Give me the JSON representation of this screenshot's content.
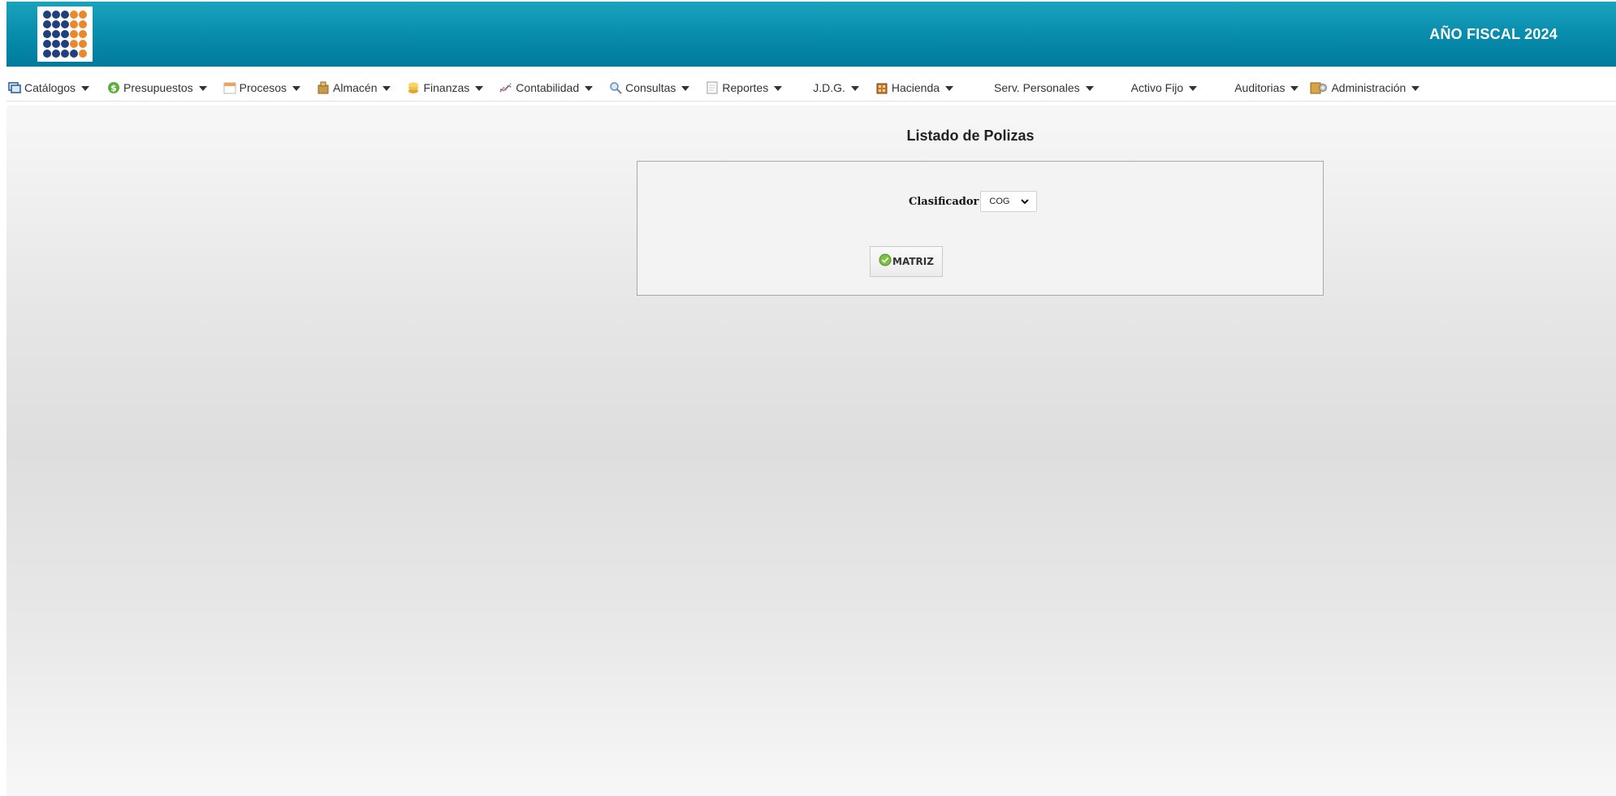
{
  "header": {
    "logo_icon": "dot-grid-logo-icon",
    "fiscal_year_label": "AÑO FISCAL  2024",
    "colors": {
      "header_bg": "#0a8fae",
      "text": "#ffffff"
    }
  },
  "menu": {
    "items": [
      {
        "label": "Catálogos",
        "icon": "window-icon",
        "has_caret": true
      },
      {
        "label": "Presupuestos",
        "icon": "dollar-icon",
        "has_caret": true
      },
      {
        "label": "Procesos",
        "icon": "calendar-icon",
        "has_caret": true
      },
      {
        "label": "Almacén",
        "icon": "box-icon",
        "has_caret": true
      },
      {
        "label": "Finanzas",
        "icon": "coins-icon",
        "has_caret": true
      },
      {
        "label": "Contabilidad",
        "icon": "chart-line-icon",
        "has_caret": true
      },
      {
        "label": "Consultas",
        "icon": "magnifier-icon",
        "has_caret": true
      },
      {
        "label": "Reportes",
        "icon": "document-icon",
        "has_caret": true
      },
      {
        "label": "J.D.G.",
        "icon": "",
        "has_caret": true
      },
      {
        "label": "Hacienda",
        "icon": "building-icon",
        "has_caret": true
      },
      {
        "label": "Serv. Personales",
        "icon": "",
        "has_caret": true
      },
      {
        "label": "Activo Fijo",
        "icon": "",
        "has_caret": true
      },
      {
        "label": "Auditorias",
        "icon": "",
        "has_caret": true
      },
      {
        "label": "Administración",
        "icon": "admin-icon",
        "has_caret": true
      }
    ]
  },
  "main": {
    "title": "Listado de Polizas",
    "form": {
      "clasificador_label": "Clasificador",
      "clasificador_value": "COG",
      "submit_label": "MATRIZ",
      "submit_icon": "check-circle-icon"
    }
  }
}
